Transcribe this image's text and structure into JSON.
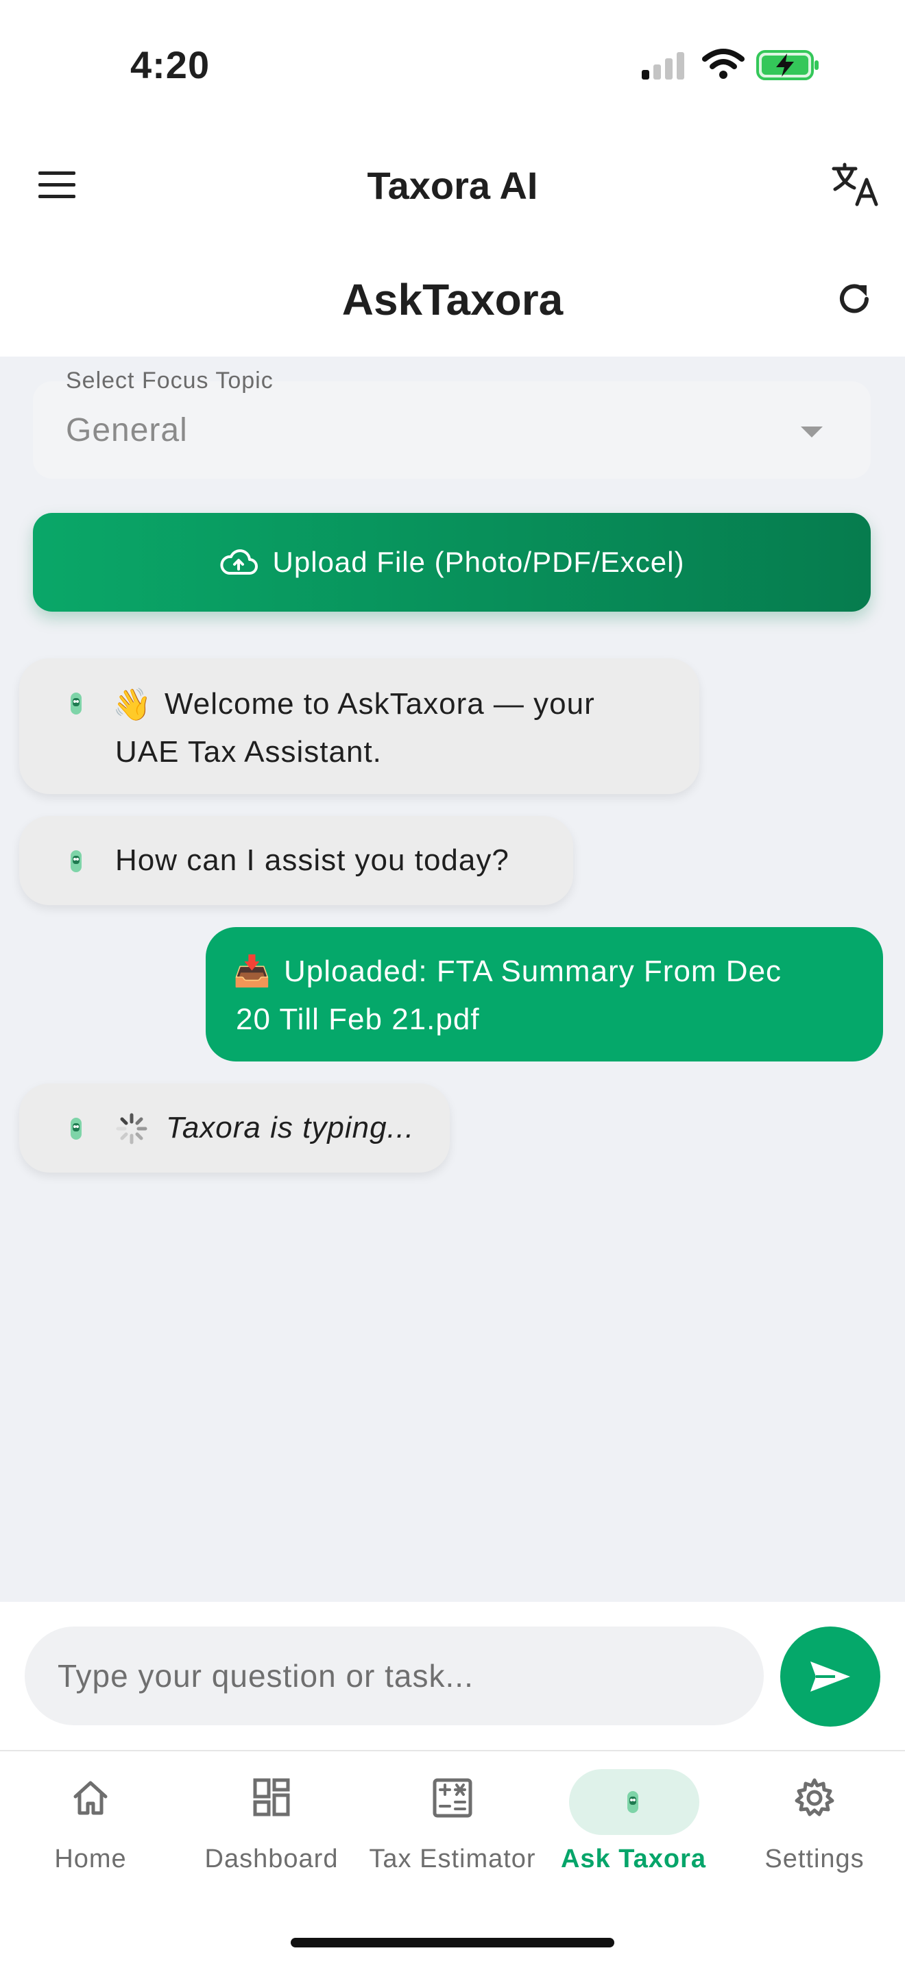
{
  "status_bar": {
    "time": "4:20"
  },
  "header": {
    "app_title": "Taxora AI",
    "page_title": "AskTaxora"
  },
  "focus_topic": {
    "label": "Select Focus Topic",
    "value": "General"
  },
  "upload_button": {
    "label": "Upload File (Photo/PDF/Excel)"
  },
  "messages": [
    {
      "sender": "bot",
      "emoji": "👋",
      "text_line1": "Welcome to AskTaxora — your",
      "text_line2": "UAE Tax Assistant."
    },
    {
      "sender": "bot",
      "text": "How can I assist you today?"
    },
    {
      "sender": "user",
      "emoji": "📥",
      "text_line1": "Uploaded: FTA Summary From Dec",
      "text_line2": "20 Till Feb 21.pdf"
    },
    {
      "sender": "bot",
      "text": "Taxora is typing..."
    }
  ],
  "composer": {
    "placeholder": "Type your question or task..."
  },
  "bottom_nav": [
    {
      "label": "Home",
      "icon": "home-icon"
    },
    {
      "label": "Dashboard",
      "icon": "dashboard-icon"
    },
    {
      "label": "Tax Estimator",
      "icon": "calculator-icon"
    },
    {
      "label": "Ask Taxora",
      "icon": "bot-icon",
      "active": true
    },
    {
      "label": "Settings",
      "icon": "gear-icon"
    }
  ],
  "colors": {
    "accent": "#05a86a",
    "accent_dark": "#067c4e",
    "bubble": "#ececec",
    "background": "#eff1f5"
  }
}
